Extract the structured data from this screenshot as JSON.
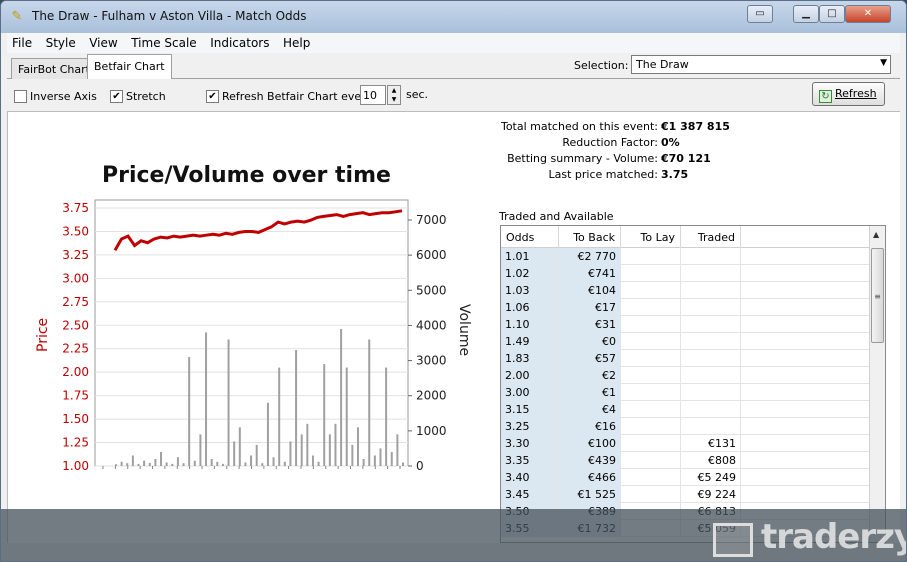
{
  "window": {
    "title": "The Draw - Fulham v Aston Villa - Match Odds"
  },
  "menu": [
    "File",
    "Style",
    "View",
    "Time Scale",
    "Indicators",
    "Help"
  ],
  "tabs": {
    "fairbot": "FairBot Chart",
    "betfair": "Betfair Chart"
  },
  "selection": {
    "label": "Selection:",
    "value": "The Draw"
  },
  "toolbar": {
    "inverse_axis": {
      "label": "Inverse Axis",
      "checked": false
    },
    "stretch": {
      "label": "Stretch",
      "checked": true
    },
    "refresh_every": {
      "label": "Refresh Betfair Chart every",
      "checked": true
    },
    "interval": "10",
    "sec": "sec.",
    "refresh_button": "Refresh"
  },
  "summary": [
    {
      "label": "Total matched on this event:",
      "value": "€1 387 815"
    },
    {
      "label": "Reduction Factor:",
      "value": "0%"
    },
    {
      "label": "Betting summary - Volume:",
      "value": "€70 121"
    },
    {
      "label": "Last price matched:",
      "value": "3.75"
    }
  ],
  "traded_available": {
    "title": "Traded and Available",
    "columns": [
      "Odds",
      "To Back",
      "To Lay",
      "Traded"
    ],
    "rows": [
      [
        "1.01",
        "€2 770",
        "",
        ""
      ],
      [
        "1.02",
        "€741",
        "",
        ""
      ],
      [
        "1.03",
        "€104",
        "",
        ""
      ],
      [
        "1.06",
        "€17",
        "",
        ""
      ],
      [
        "1.10",
        "€31",
        "",
        ""
      ],
      [
        "1.49",
        "€0",
        "",
        ""
      ],
      [
        "1.83",
        "€57",
        "",
        ""
      ],
      [
        "2.00",
        "€2",
        "",
        ""
      ],
      [
        "3.00",
        "€1",
        "",
        ""
      ],
      [
        "3.15",
        "€4",
        "",
        ""
      ],
      [
        "3.25",
        "€16",
        "",
        ""
      ],
      [
        "3.30",
        "€100",
        "",
        "€131"
      ],
      [
        "3.35",
        "€439",
        "",
        "€808"
      ],
      [
        "3.40",
        "€466",
        "",
        "€5 249"
      ],
      [
        "3.45",
        "€1 525",
        "",
        "€9 224"
      ],
      [
        "3.50",
        "€389",
        "",
        "€6 813"
      ],
      [
        "3.55",
        "€1 732",
        "",
        "€5 059"
      ]
    ]
  },
  "chart_data": {
    "type": "line",
    "title": "Price/Volume over time",
    "ylabel": "Price",
    "y2label": "Volume",
    "ylim": [
      1.0,
      3.75
    ],
    "y2lim": [
      0,
      7000
    ],
    "yticks": [
      "3.75",
      "3.50",
      "3.25",
      "3.00",
      "2.75",
      "2.50",
      "2.25",
      "2.00",
      "1.75",
      "1.50",
      "1.25",
      "1.00"
    ],
    "y2ticks": [
      "7000",
      "6000",
      "5000",
      "4000",
      "3000",
      "2000",
      "1000",
      "0"
    ],
    "price_series": {
      "color": "#c00000",
      "values": [
        3.3,
        3.42,
        3.45,
        3.35,
        3.4,
        3.38,
        3.42,
        3.44,
        3.43,
        3.45,
        3.44,
        3.45,
        3.46,
        3.45,
        3.46,
        3.47,
        3.46,
        3.48,
        3.47,
        3.49,
        3.5,
        3.5,
        3.49,
        3.52,
        3.55,
        3.6,
        3.58,
        3.6,
        3.61,
        3.6,
        3.62,
        3.65,
        3.66,
        3.67,
        3.68,
        3.66,
        3.68,
        3.69,
        3.7,
        3.68,
        3.69,
        3.7,
        3.7,
        3.71,
        3.72
      ]
    },
    "volume_series": {
      "color": "#a0a0a0",
      "values": [
        50,
        120,
        80,
        300,
        60,
        150,
        90,
        200,
        400,
        100,
        60,
        250,
        80,
        3100,
        150,
        900,
        3800,
        200,
        120,
        60,
        3600,
        700,
        1100,
        100,
        300,
        600,
        80,
        1800,
        250,
        2800,
        120,
        700,
        3300,
        900,
        1200,
        300,
        120,
        2900,
        900,
        1200,
        3900,
        2800,
        600,
        1100,
        200,
        3600,
        300,
        500,
        2800,
        400,
        900,
        100
      ]
    },
    "grid": true
  },
  "watermark": "traderzy.pl"
}
